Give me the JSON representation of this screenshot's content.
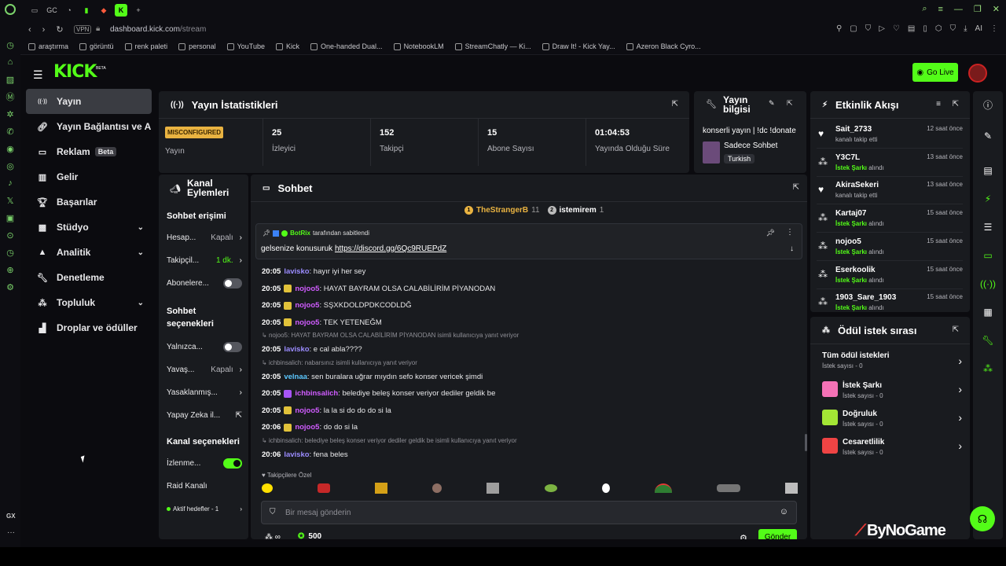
{
  "browser": {
    "tabs": [
      "GC",
      "K"
    ],
    "address": "dashboard.kick.com/stream",
    "address_host": "dashboard.kick.com",
    "address_path": "/stream",
    "vpn": "VPN",
    "bookmarks": [
      "araştırma",
      "görüntü",
      "renk paleti",
      "personal",
      "YouTube",
      "Kick",
      "One-handed Dual...",
      "NotebookLM",
      "StreamChatly — Ki...",
      "Draw It! - Kick Yay...",
      "Azeron Black Cyro..."
    ],
    "side_bottom": "GX",
    "ai_label": "AI"
  },
  "header": {
    "logo": "KICK",
    "beta": "BETA",
    "go_live": "Go Live"
  },
  "nav": [
    {
      "label": "Yayın",
      "icon": "broadcast-icon"
    },
    {
      "label": "Yayın Bağlantısı ve Anahtar",
      "icon": "link-icon"
    },
    {
      "label": "Reklam",
      "badge": "Beta",
      "icon": "ad-icon"
    },
    {
      "label": "Gelir",
      "icon": "chart-icon"
    },
    {
      "label": "Başarılar",
      "icon": "trophy-icon"
    },
    {
      "label": "Stüdyo",
      "icon": "studio-icon"
    },
    {
      "label": "Analitik",
      "icon": "analytics-icon"
    },
    {
      "label": "Denetleme",
      "icon": "wrench-icon"
    },
    {
      "label": "Topluluk",
      "icon": "people-icon"
    },
    {
      "label": "Droplar ve ödüller",
      "icon": "drops-icon"
    }
  ],
  "stats": {
    "title": "Yayın İstatistikleri",
    "misconfigured": "MISCONFIGURED",
    "stream_label": "Yayın",
    "items": [
      {
        "value": "25",
        "label": "İzleyici"
      },
      {
        "value": "152",
        "label": "Takipçi"
      },
      {
        "value": "15",
        "label": "Abone Sayısı"
      },
      {
        "value": "01:04:53",
        "label": "Yayında Olduğu Süre"
      }
    ]
  },
  "stream_info": {
    "title_l1": "Yayın",
    "title_l2": "bilgisi",
    "stream_title": "konserli yayın | !dc !donate",
    "category": "Sadece Sohbet",
    "language": "Turkish"
  },
  "channel_actions": {
    "title_l1": "Kanal",
    "title_l2": "Eylemleri",
    "chat_access": "Sohbet erişimi",
    "rows1": [
      {
        "label": "Hesap...",
        "value": "Kapalı"
      },
      {
        "label": "Takipçil...",
        "value": "1 dk."
      },
      {
        "label": "Abonelere..."
      }
    ],
    "chat_options_l1": "Sohbet",
    "chat_options_l2": "seçenekleri",
    "rows2": [
      {
        "label": "Yalnızca..."
      },
      {
        "label": "Yavaş...",
        "value": "Kapalı"
      },
      {
        "label": "Yasaklanmış..."
      },
      {
        "label": "Yapay Zeka il..."
      }
    ],
    "channel_options": "Kanal seçenekleri",
    "rows3": [
      {
        "label": "İzlenme..."
      },
      {
        "label": "Raid Kanalı"
      },
      {
        "label": "Aktif hedefler - 1"
      }
    ]
  },
  "chat": {
    "title": "Sohbet",
    "top": [
      {
        "rank": "1",
        "name": "TheStrangerB",
        "count": "11"
      },
      {
        "rank": "2",
        "name": "istemirem",
        "count": "1"
      }
    ],
    "pinned_by": "BotRix",
    "pinned_suffix": "tarafından sabitlendi",
    "pinned_text": "gelsenize konusuruk",
    "pinned_link": "https://discord.gg/6Qc9RUEPdZ",
    "messages": [
      {
        "time": "20:05",
        "user": "lavisko",
        "color": "#9b8cff",
        "text": ": hayır iyi her sey"
      },
      {
        "time": "20:05",
        "user": "nojoo5",
        "color": "#d05cff",
        "badge": true,
        "text": ": HAYAT BAYRAM OLSA CALABİLİRİM PİYANODAN"
      },
      {
        "time": "20:05",
        "user": "nojoo5",
        "color": "#d05cff",
        "badge": true,
        "text": ": SŞXKDOLDPDKCODLDĞ"
      },
      {
        "time": "20:05",
        "user": "nojoo5",
        "color": "#d05cff",
        "badge": true,
        "text": ": TEK YETENEĞM"
      },
      {
        "reply": "nojoo5: HAYAT BAYRAM OLSA CALABİLİRİM PİYANODAN isimli kullanıcıya yanıt veriyor"
      },
      {
        "time": "20:05",
        "user": "lavisko",
        "color": "#9b8cff",
        "text": ": e cal abla????"
      },
      {
        "reply": "ichbinsalich: nabarsınız isimli kullanıcıya yanıt veriyor"
      },
      {
        "time": "20:05",
        "user": "velnaa",
        "color": "#5cc8ff",
        "text": ": sen buralara uğrar mıydın sefo konser vericek şimdi"
      },
      {
        "time": "20:05",
        "user": "ichbinsalich",
        "color": "#d05cff",
        "badge": true,
        "badgep": true,
        "text": ": belediye beleş konser veriyor dediler geldik be"
      },
      {
        "time": "20:05",
        "user": "nojoo5",
        "color": "#d05cff",
        "badge": true,
        "text": ": la la si do do do si la"
      },
      {
        "time": "20:06",
        "user": "nojoo5",
        "color": "#d05cff",
        "badge": true,
        "text": ": do do si la"
      },
      {
        "reply": "ichbinsalich: belediye beleş konser veriyor dediler geldik be isimli kullanıcıya yanıt veriyor"
      },
      {
        "time": "20:06",
        "user": "lavisko",
        "color": "#9b8cff",
        "text": ": fena beles"
      }
    ],
    "emote_title": "Takipçilere Özel",
    "input_placeholder": "Bir mesaj gönderin",
    "points": "500",
    "send": "Gönder"
  },
  "activity": {
    "title": "Etkinlik Akışı",
    "items": [
      {
        "name": "Sait_2733",
        "desc": "kanalı takip etti",
        "time": "12 saat önce",
        "icon": "heart-icon"
      },
      {
        "name": "Y3C7L",
        "desc_hl": "İstek Şarkı",
        "desc": " alındı",
        "time": "13 saat önce",
        "icon": "reward-icon"
      },
      {
        "name": "AkiraSekeri",
        "desc": "kanalı takip etti",
        "time": "13 saat önce",
        "icon": "heart-icon"
      },
      {
        "name": "Kartaj07",
        "desc_hl": "İstek Şarkı",
        "desc": " alındı",
        "time": "15 saat önce",
        "icon": "reward-icon"
      },
      {
        "name": "nojoo5",
        "desc_hl": "İstek Şarkı",
        "desc": " alındı",
        "time": "15 saat önce",
        "icon": "reward-icon"
      },
      {
        "name": "Eserkoolik",
        "desc_hl": "İstek Şarkı",
        "desc": " alındı",
        "time": "15 saat önce",
        "icon": "reward-icon"
      },
      {
        "name": "1903_Sare_1903",
        "desc_hl": "İstek Şarkı",
        "desc": " alındı",
        "time": "15 saat önce",
        "icon": "reward-icon"
      }
    ]
  },
  "rewards": {
    "title": "Ödül istek sırası",
    "all": "Tüm ödül istekleri",
    "all_sub": "İstek sayısı - 0",
    "items": [
      {
        "name": "İstek Şarkı",
        "sub": "İstek sayısı - 0",
        "color": "#f472b6"
      },
      {
        "name": "Doğruluk",
        "sub": "İstek sayısı - 0",
        "color": "#a3e635"
      },
      {
        "name": "Cesaretlilik",
        "sub": "İstek sayısı - 0",
        "color": "#ef4444"
      }
    ]
  },
  "watermark": "ByNoGame"
}
